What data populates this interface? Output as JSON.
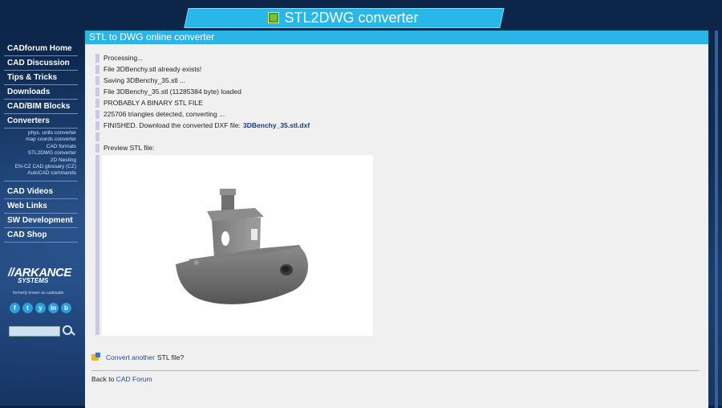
{
  "header": {
    "title": "STL2DWG converter",
    "icon": "stl-file-icon"
  },
  "sidebar": {
    "items": [
      {
        "label": "CADforum Home"
      },
      {
        "label": "CAD Discussion"
      },
      {
        "label": "Tips & Tricks"
      },
      {
        "label": "Downloads"
      },
      {
        "label": "CAD/BIM Blocks"
      },
      {
        "label": "Converters"
      }
    ],
    "subitems": [
      "phys. units converter",
      "map coords converter",
      "CAD formats",
      "STL2DWG converter",
      "2D Nesting",
      "EN-CZ CAD glossary (CZ)",
      "AutoCAD commands"
    ],
    "items2": [
      {
        "label": "CAD Videos"
      },
      {
        "label": "Web Links"
      },
      {
        "label": "SW Development"
      },
      {
        "label": "CAD Shop"
      }
    ],
    "logo_main": "ARKANCE",
    "logo_sub": "SYSTEMS",
    "formerly": "formerly known as cadstudio",
    "social": [
      "f",
      "t",
      "y",
      "in",
      "b"
    ]
  },
  "main": {
    "panel_title": "STL to DWG online converter",
    "log": [
      "Processing...",
      "File 3DBenchy.stl already exists!",
      "Saving 3DBenchy_35.stl ...",
      "File 3DBenchy_35.stl (11285384 byte) loaded",
      "PROBABLY A BINARY STL FILE",
      "225706 triangles detected, converting ..."
    ],
    "finished_text": "FINISHED. Download the converted DXF file:",
    "download_link": "3DBenchy_35.stl.dxf",
    "preview_label": "Preview STL file:",
    "convert_link": "Convert another",
    "convert_rest": "STL file?",
    "back_text": "Back to",
    "back_link": "CAD Forum"
  }
}
